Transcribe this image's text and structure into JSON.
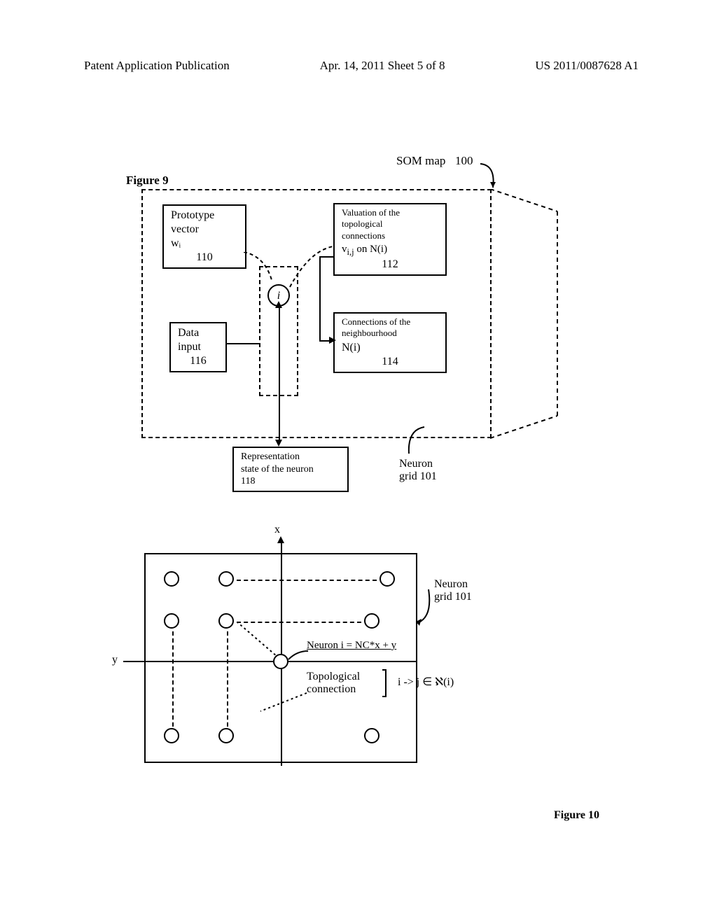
{
  "header": {
    "left": "Patent Application Publication",
    "center": "Apr. 14, 2011  Sheet 5 of 8",
    "right": "US 2011/0087628 A1"
  },
  "fig9": {
    "title": "Figure 9",
    "som_label": "SOM map",
    "som_ref": "100",
    "prototype": {
      "l1": "Prototype",
      "l2": "vector",
      "sym": "wᵢ",
      "ref": "110"
    },
    "valuation": {
      "l1": "Valuation of the",
      "l2": "topological",
      "l3": "connections",
      "sym_pre": "v",
      "sym_sub": "i,j",
      "sym_mid": " on   ",
      "sym_N": "N(i)",
      "ref": "112"
    },
    "neuron": "i",
    "datainput": {
      "l1": "Data",
      "l2": "input",
      "ref": "116"
    },
    "neighbourhood": {
      "l1": "Connections of the",
      "l2": "neighbourhood",
      "sym": "N(i)",
      "ref": "114"
    },
    "repr": {
      "l1": "Representation",
      "l2": "state of the neuron",
      "ref": "118"
    },
    "neuron_grid": {
      "l1": "Neuron",
      "l2": "grid 101"
    }
  },
  "fig10": {
    "x": "x",
    "y": "y",
    "neuron_eq_pre": "Neuron   i = NC*x + ",
    "neuron_eq_y": "y",
    "topo_l1": "Topological",
    "topo_l2": "connection",
    "topo_rhs": "i -> j ∈ ℵ(i)",
    "grid_l1": "Neuron",
    "grid_l2": "grid 101",
    "caption": "Figure 10"
  }
}
